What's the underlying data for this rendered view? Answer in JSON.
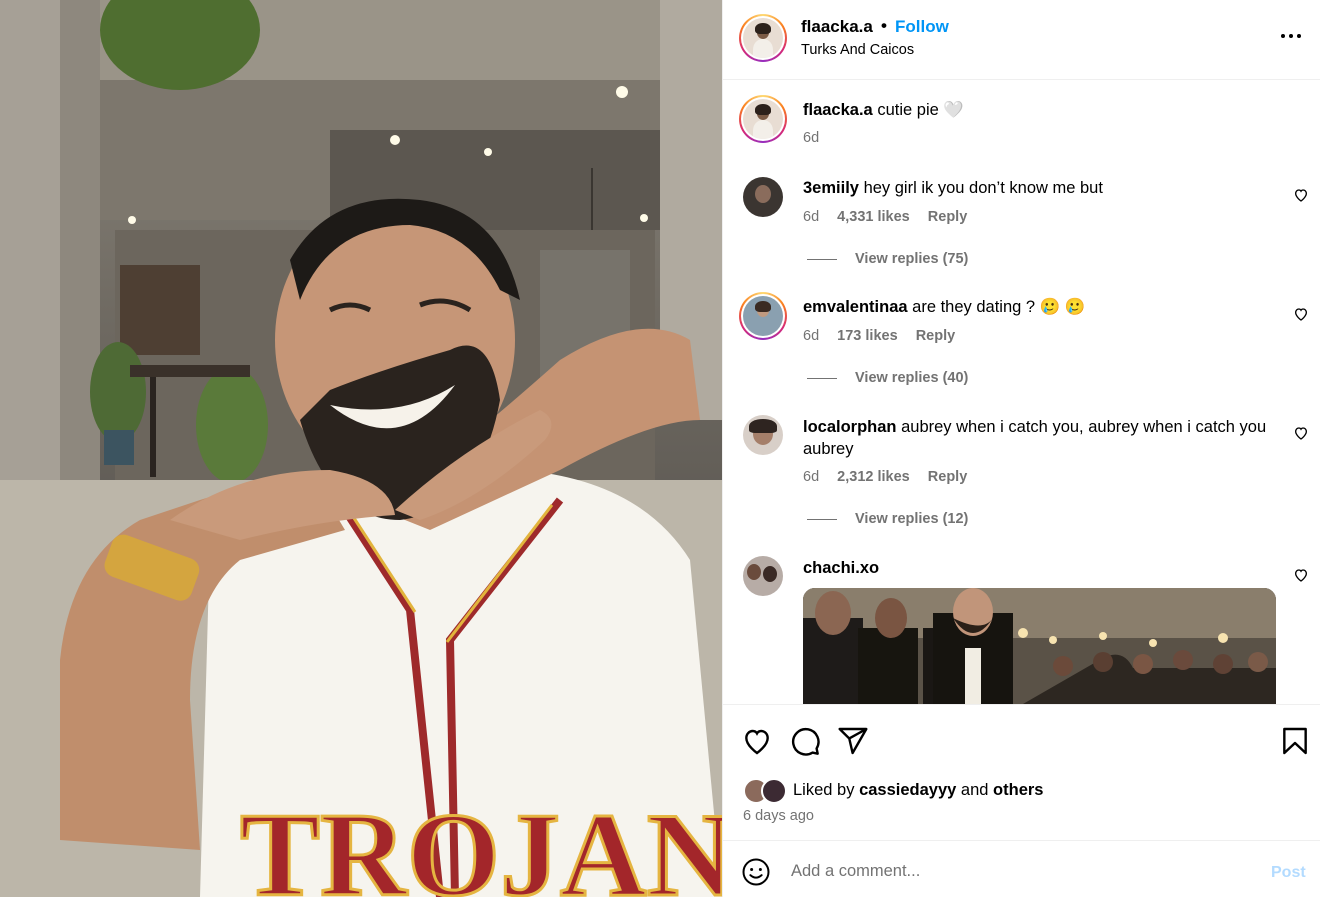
{
  "header": {
    "username": "flaacka.a",
    "separator": "•",
    "follow_label": "Follow",
    "location": "Turks And Caicos",
    "more_icon": "more-horizontal-icon"
  },
  "photo": {
    "jersey_text": "TROJANS"
  },
  "caption": {
    "username": "flaacka.a",
    "text": "cutie pie 🤍",
    "time": "6d"
  },
  "comments": [
    {
      "username": "3emiily",
      "text": "hey girl ik you don’t know me but",
      "time": "6d",
      "likes": "4,331 likes",
      "reply_label": "Reply",
      "view_replies": "View replies (75)"
    },
    {
      "username": "emvalentinaa",
      "text": "are they dating ? 🥲 🥲",
      "time": "6d",
      "likes": "173 likes",
      "reply_label": "Reply",
      "view_replies": "View replies (40)"
    },
    {
      "username": "localorphan",
      "text": "aubrey when i catch you, aubrey when i catch you aubrey",
      "time": "6d",
      "likes": "2,312 likes",
      "reply_label": "Reply",
      "view_replies": "View replies (12)"
    },
    {
      "username": "chachi.xo",
      "text": ""
    }
  ],
  "actions": {
    "like_icon": "heart-icon",
    "comment_icon": "comment-icon",
    "share_icon": "send-icon",
    "save_icon": "bookmark-icon"
  },
  "liked_by": {
    "prefix": "Liked by",
    "user": "cassiedayyy",
    "and": "and",
    "others": "others"
  },
  "timestamp": "6 days ago",
  "add_comment": {
    "placeholder": "Add a comment...",
    "post_label": "Post"
  },
  "colors": {
    "link_blue": "#0095f6",
    "post_disabled": "#b3dbff",
    "secondary_text": "#737373",
    "divider": "#efefef"
  }
}
